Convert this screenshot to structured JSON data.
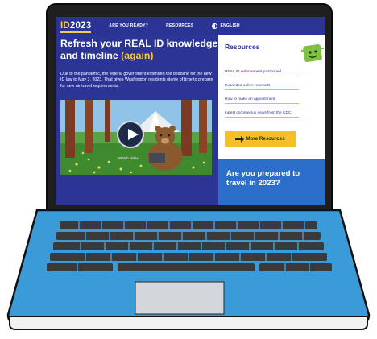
{
  "site": {
    "logo_prefix": "ID",
    "logo_suffix": "2023",
    "nav": [
      {
        "label": "ARE YOU READY?"
      },
      {
        "label": "RESOURCES"
      },
      {
        "label": "ENGLISH",
        "icon": "globe-icon"
      }
    ]
  },
  "hero": {
    "headline": "Refresh your REAL ID knowledge and timeline",
    "headline_highlight": "(again)",
    "body": "Due to the pandemic, the federal government extended the deadline for the new ID law to May 3, 2023. That gives Washington residents plenty of time to prepare for new air travel requirements.",
    "video_label": "Watch video"
  },
  "resources": {
    "title": "Resources",
    "links": [
      "REAL ID enforcement postponed",
      "Expanded online renewals",
      "How to make an appointment",
      "Latest coronavirus news from the CDC"
    ],
    "more_button": "More Resources"
  },
  "promo": {
    "text": "Are you prepared to travel in 2023?"
  },
  "colors": {
    "navy": "#2c3596",
    "gold": "#f5bf27",
    "blue": "#2c6fca",
    "laptop_blue": "#3b9bd9"
  }
}
